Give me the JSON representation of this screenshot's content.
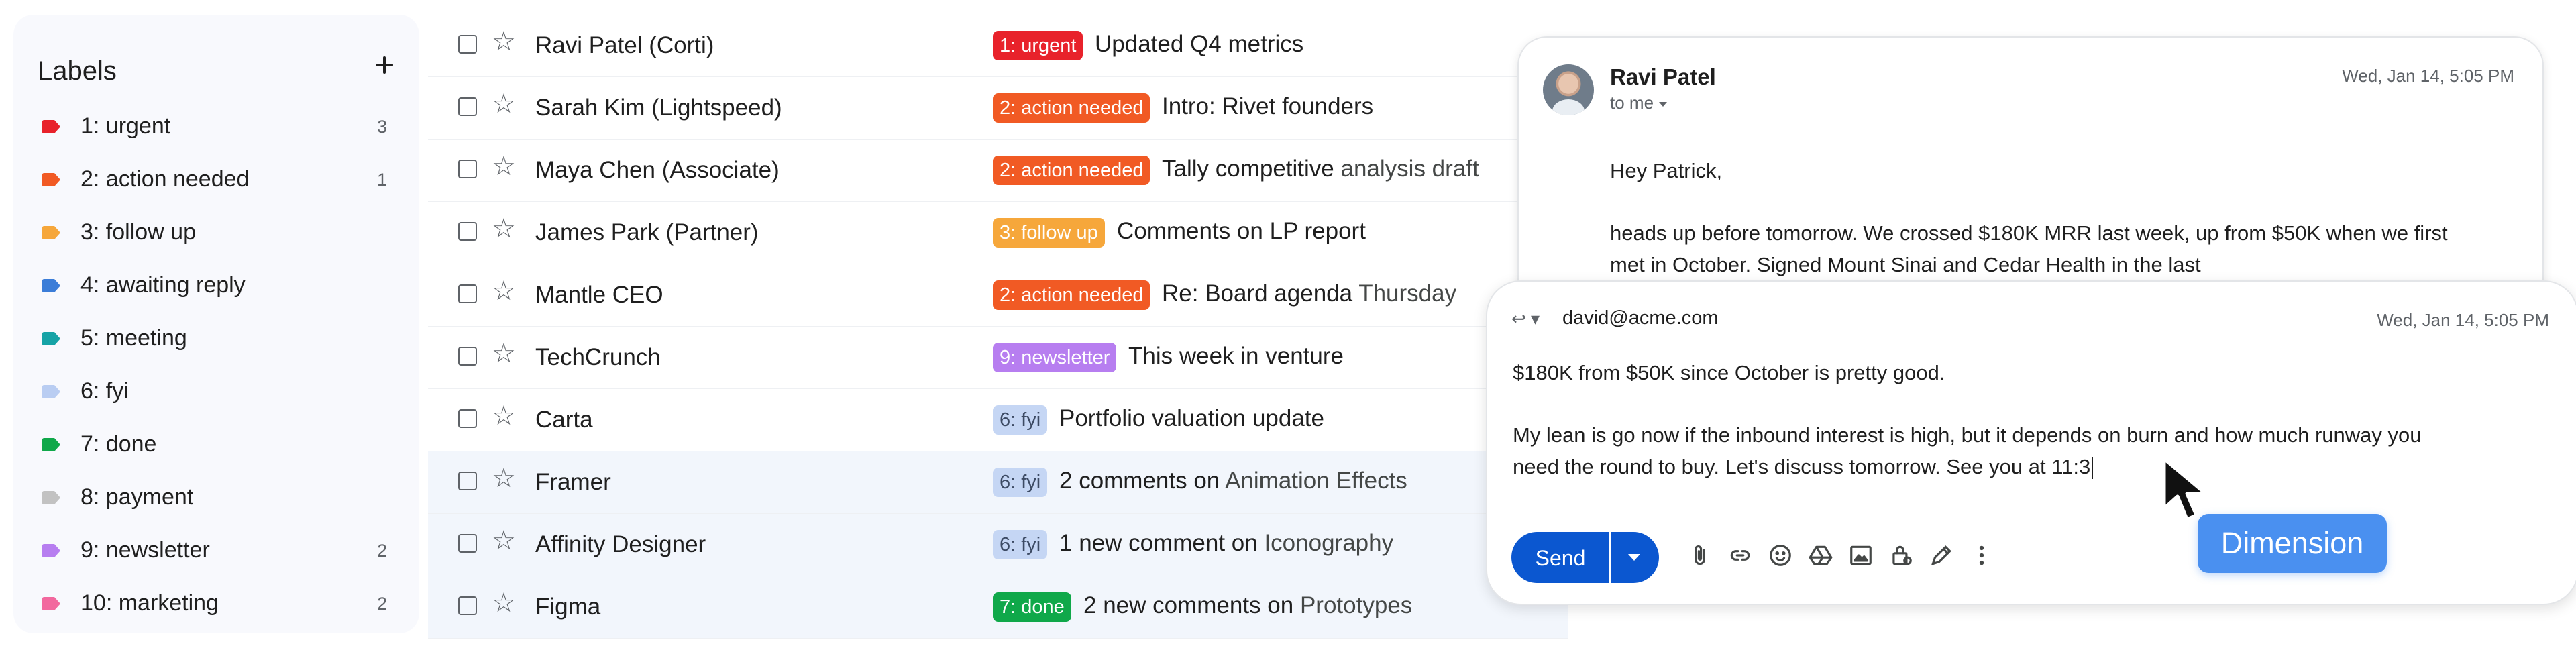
{
  "labels": {
    "title": "Labels",
    "items": [
      {
        "name": "1: urgent",
        "count": "3",
        "color": "#e8222b"
      },
      {
        "name": "2: action needed",
        "count": "1",
        "color": "#f15a24"
      },
      {
        "name": "3: follow up",
        "count": "",
        "color": "#f6a73b"
      },
      {
        "name": "4: awaiting reply",
        "count": "",
        "color": "#3b7dd8"
      },
      {
        "name": "5: meeting",
        "count": "",
        "color": "#16a3a6"
      },
      {
        "name": "6: fyi",
        "count": "",
        "color": "#b9cdf2"
      },
      {
        "name": "7: done",
        "count": "",
        "color": "#10a84a"
      },
      {
        "name": "8: payment",
        "count": "",
        "color": "#c2c2c2"
      },
      {
        "name": "9: newsletter",
        "count": "2",
        "color": "#b77ef0"
      },
      {
        "name": "10: marketing",
        "count": "2",
        "color": "#f2689e"
      }
    ]
  },
  "emails": [
    {
      "sender": "Ravi Patel (Corti)",
      "tag": "1: urgent",
      "tag_bg": "#e8222b",
      "tag_fg": "#ffffff",
      "subject": "Updated Q4 metrics",
      "snippet": "",
      "read": false
    },
    {
      "sender": "Sarah Kim (Lightspeed)",
      "tag": "2: action needed",
      "tag_bg": "#f15a24",
      "tag_fg": "#ffffff",
      "subject": "Intro: Rivet founders",
      "snippet": "",
      "read": false
    },
    {
      "sender": "Maya Chen (Associate)",
      "tag": "2: action needed",
      "tag_bg": "#f15a24",
      "tag_fg": "#ffffff",
      "subject": "Tally competitive",
      "snippet": "analysis draft",
      "read": false
    },
    {
      "sender": "James Park (Partner)",
      "tag": "3: follow up",
      "tag_bg": "#f6a73b",
      "tag_fg": "#ffffff",
      "subject": "Comments on LP report",
      "snippet": "",
      "read": false
    },
    {
      "sender": "Mantle CEO",
      "tag": "2: action needed",
      "tag_bg": "#f15a24",
      "tag_fg": "#ffffff",
      "subject": "Re: Board agenda",
      "snippet": "Thursday",
      "read": false
    },
    {
      "sender": "TechCrunch",
      "tag": "9: newsletter",
      "tag_bg": "#b77ef0",
      "tag_fg": "#ffffff",
      "subject": "This week in venture",
      "snippet": "",
      "read": false
    },
    {
      "sender": "Carta",
      "tag": "6: fyi",
      "tag_bg": "#c5d6f4",
      "tag_fg": "#3c4a63",
      "subject": "Portfolio valuation update",
      "snippet": "",
      "read": false
    },
    {
      "sender": "Framer",
      "tag": "6: fyi",
      "tag_bg": "#c5d6f4",
      "tag_fg": "#3c4a63",
      "subject": "2 comments on",
      "snippet": "Animation Effects",
      "read": true
    },
    {
      "sender": "Affinity Designer",
      "tag": "6: fyi",
      "tag_bg": "#c5d6f4",
      "tag_fg": "#3c4a63",
      "subject": "1 new comment on",
      "snippet": "Iconography",
      "read": true
    },
    {
      "sender": "Figma",
      "tag": "7: done",
      "tag_bg": "#10a84a",
      "tag_fg": "#ffffff",
      "subject": "2 new comments on",
      "snippet": "Prototypes",
      "read": true
    }
  ],
  "message": {
    "from": "Ravi Patel",
    "to": "to me",
    "date": "Wed, Jan 14, 5:05 PM",
    "greeting": "Hey Patrick,",
    "body": "heads up before tomorrow. We crossed $180K MRR last week, up from $50K when we first met in October. Signed Mount Sinai and Cedar Health in the last"
  },
  "reply": {
    "to": "david@acme.com",
    "date": "Wed, Jan 14, 5:05 PM",
    "line1": "$180K from $50K since October is pretty good.",
    "line2": "My lean is go now if the inbound interest is high, but it depends on burn and how much runway you need the round to buy. Let's discuss tomorrow. See you at 11:3",
    "send_label": "Send"
  },
  "tooltip": {
    "label": "Dimension"
  }
}
